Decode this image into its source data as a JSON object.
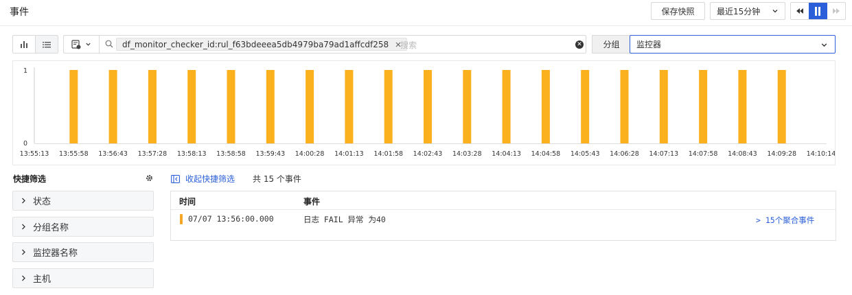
{
  "header": {
    "title": "事件",
    "save_snapshot_label": "保存快照",
    "time_range_label": "最近15分钟"
  },
  "toolbar": {
    "filter_tag": "df_monitor_checker_id:rul_f63bdeeea5db4979ba79ad1affcdf258",
    "search_placeholder": "搜索",
    "group_label": "分组",
    "group_value": "监控器"
  },
  "chart_data": {
    "type": "bar",
    "x": [
      "13:55:58",
      "13:56:43",
      "13:57:28",
      "13:58:13",
      "13:58:58",
      "13:59:43",
      "14:00:28",
      "14:01:13",
      "14:01:58",
      "14:02:43",
      "14:03:28",
      "14:04:13",
      "14:04:58",
      "14:05:43",
      "14:06:28",
      "14:07:13",
      "14:07:58",
      "14:08:43",
      "14:09:28"
    ],
    "values": [
      1,
      1,
      1,
      1,
      1,
      1,
      1,
      1,
      1,
      1,
      1,
      1,
      1,
      1,
      1,
      1,
      1,
      1,
      1
    ],
    "tick_labels": [
      "13:55:13",
      "13:55:58",
      "13:56:43",
      "13:57:28",
      "13:58:13",
      "13:58:58",
      "13:59:43",
      "14:00:28",
      "14:01:13",
      "14:01:58",
      "14:02:43",
      "14:03:28",
      "14:04:13",
      "14:04:58",
      "14:05:43",
      "14:06:28",
      "14:07:13",
      "14:07:58",
      "14:08:43",
      "14:09:28",
      "14:10:14"
    ],
    "y_ticks": [
      "1",
      "0"
    ],
    "ylim": [
      0,
      1
    ],
    "bar_color": "#FBB01E",
    "grid": false
  },
  "quick_filter": {
    "title": "快捷筛选",
    "items": [
      {
        "label": "状态"
      },
      {
        "label": "分组名称"
      },
      {
        "label": "监控器名称"
      },
      {
        "label": "主机"
      }
    ]
  },
  "events": {
    "collapse_label": "收起快捷筛选",
    "count_text": "共 15 个事件",
    "columns": [
      "时间",
      "事件"
    ],
    "rows": [
      {
        "time": "07/07 13:56:00.000",
        "event": "日志 FAIL 异常 为40",
        "aggregate": "> 15个聚合事件",
        "status_color": "#F5A623"
      }
    ]
  },
  "colors": {
    "accent": "#2B5FD9",
    "bar": "#FBB01E"
  }
}
